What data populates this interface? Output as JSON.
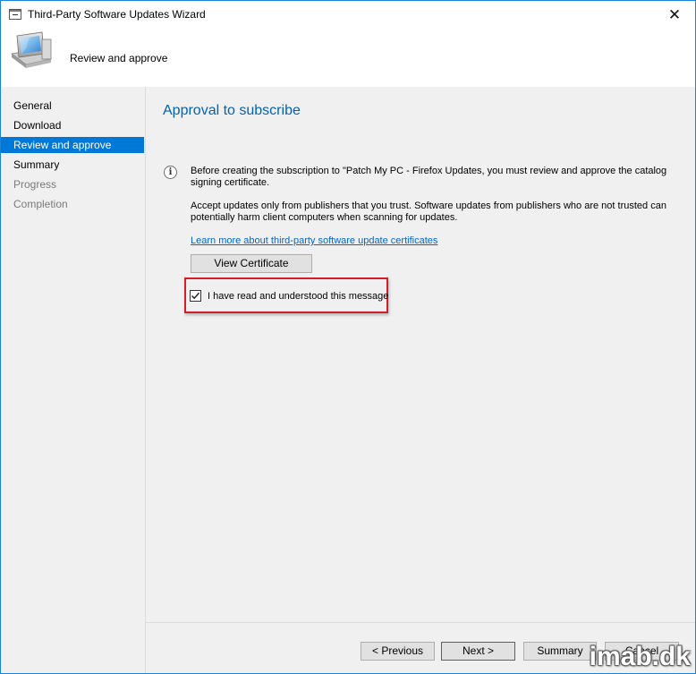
{
  "window": {
    "title": "Third-Party Software Updates Wizard",
    "close_glyph": "✕"
  },
  "header": {
    "title": "Review and approve",
    "icon": "computer-icon"
  },
  "nav": {
    "items": [
      {
        "label": "General",
        "state": "normal"
      },
      {
        "label": "Download",
        "state": "normal"
      },
      {
        "label": "Review and approve",
        "state": "selected"
      },
      {
        "label": "Summary",
        "state": "normal"
      },
      {
        "label": "Progress",
        "state": "disabled"
      },
      {
        "label": "Completion",
        "state": "disabled"
      }
    ]
  },
  "main": {
    "page_title": "Approval to subscribe",
    "info_glyph": "i",
    "message_1_line_1": "Before creating the subscription to \"Patch My PC - Firefox Updates, you must review and approve the catalog",
    "message_1_line_2": "signing certificate.",
    "message_2_line_1": "Accept updates only from publishers that you trust. Software updates from publishers who are not trusted can",
    "message_2_line_2": "potentially harm client computers when scanning for updates.",
    "learn_more_link": "Learn more about third-party software update certificates",
    "view_certificate_label": "View Certificate",
    "acknowledge_label": "I have read and understood this message",
    "acknowledge_checked": true
  },
  "footer": {
    "previous_label": "< Previous",
    "next_label": "Next >",
    "summary_label": "Summary",
    "cancel_label": "Cancel"
  },
  "watermark": "imab.dk",
  "colors": {
    "accent": "#0078d7",
    "link": "#0066cc",
    "title_blue": "#0063b1",
    "highlight_red": "#d41d28",
    "panel_bg": "#f0f0f0"
  }
}
